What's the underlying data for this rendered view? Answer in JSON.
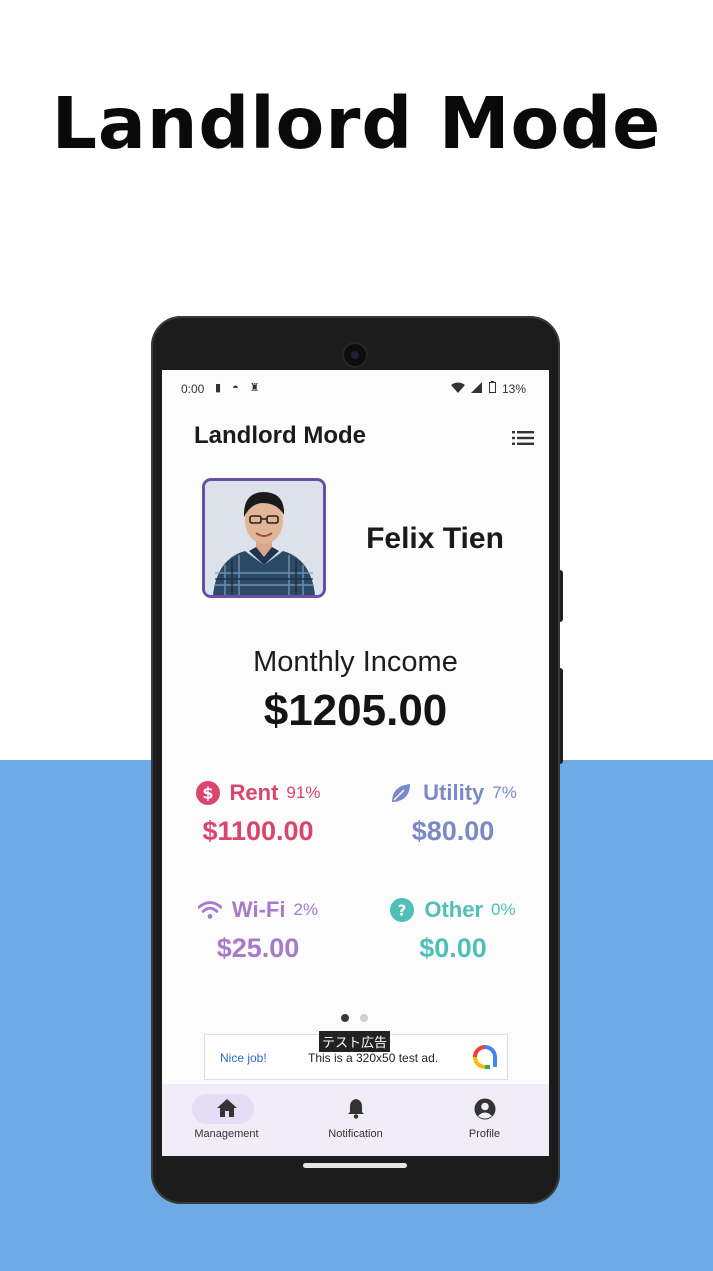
{
  "hero": {
    "title": "Landlord Mode"
  },
  "status_bar": {
    "time": "0:00",
    "battery": "13%"
  },
  "app_bar": {
    "title": "Landlord Mode",
    "menu_icon": "list-icon"
  },
  "profile": {
    "name": "Felix Tien"
  },
  "income": {
    "label": "Monthly Income",
    "value": "$1205.00"
  },
  "categories": [
    {
      "name": "Rent",
      "percent": "91%",
      "amount": "$1100.00",
      "color": "#d9456d",
      "icon": "dollar-circle-icon"
    },
    {
      "name": "Utility",
      "percent": "7%",
      "amount": "$80.00",
      "color": "#7b8ac6",
      "icon": "leaf-icon"
    },
    {
      "name": "Wi-Fi",
      "percent": "2%",
      "amount": "$25.00",
      "color": "#a77bcb",
      "icon": "wifi-icon"
    },
    {
      "name": "Other",
      "percent": "0%",
      "amount": "$0.00",
      "color": "#4fc0b8",
      "icon": "question-circle-icon"
    }
  ],
  "pager": {
    "current": 1,
    "total": 2
  },
  "ad": {
    "left_text": "Nice job!",
    "body": "This is a 320x50 test ad.",
    "tag": "テスト広告"
  },
  "bottom_nav": [
    {
      "label": "Management",
      "icon": "home-icon",
      "active": true
    },
    {
      "label": "Notification",
      "icon": "bell-icon",
      "active": false
    },
    {
      "label": "Profile",
      "icon": "account-circle-icon",
      "active": false
    }
  ],
  "colors": {
    "background_blue": "#6eaae6",
    "avatar_border": "#6a4fa8",
    "nav_bg": "#f0ecf8"
  }
}
